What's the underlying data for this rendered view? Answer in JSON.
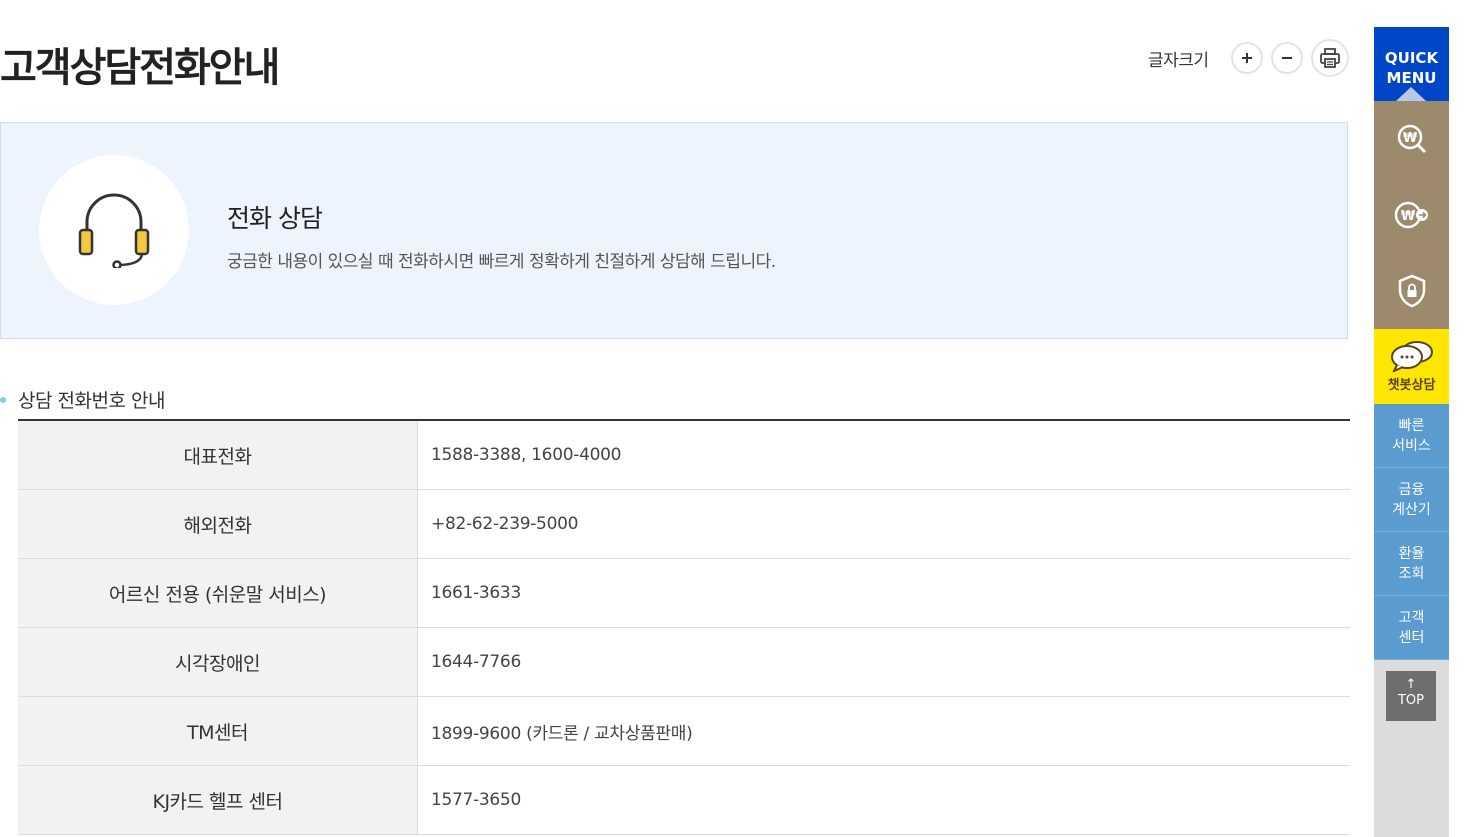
{
  "page": {
    "title": "고객상담전화안내"
  },
  "font_tools": {
    "label": "글자크기",
    "increase": "+",
    "decrease": "−"
  },
  "intro": {
    "heading": "전화 상담",
    "description": "궁금한 내용이 있으실 때 전화하시면 빠르게 정확하게 친절하게 상담해 드립니다."
  },
  "section": {
    "title": "상담 전화번호 안내"
  },
  "rows": [
    {
      "label": "대표전화",
      "value": "1588-3388, 1600-4000"
    },
    {
      "label": "해외전화",
      "value": "+82-62-239-5000"
    },
    {
      "label": "어르신 전용 (쉬운말 서비스)",
      "value": "1661-3633"
    },
    {
      "label": "시각장애인",
      "value": "1644-7766"
    },
    {
      "label": "TM센터",
      "value": "1899-9600 (카드론 / 교차상품판매)"
    },
    {
      "label": "KJ카드 헬프 센터",
      "value": "1577-3650"
    }
  ],
  "quick_menu": {
    "title_line1": "QUICK",
    "title_line2": "MENU",
    "icons": [
      "won-search-icon",
      "won-transfer-icon",
      "shield-lock-icon"
    ],
    "chatbot": "챗봇상담",
    "items": [
      "빠른\n서비스",
      "금융\n계산기",
      "환율\n조회",
      "고객\n센터"
    ],
    "top_label": "TOP"
  },
  "colors": {
    "quick_header": "#0046c8",
    "quick_icon_bg": "#9d8a6c",
    "chatbot_bg": "#ffe600",
    "quick_item_bg": "#5a9bd0",
    "intro_bg": "#eef4fd",
    "headset_accent": "#f5c842"
  }
}
